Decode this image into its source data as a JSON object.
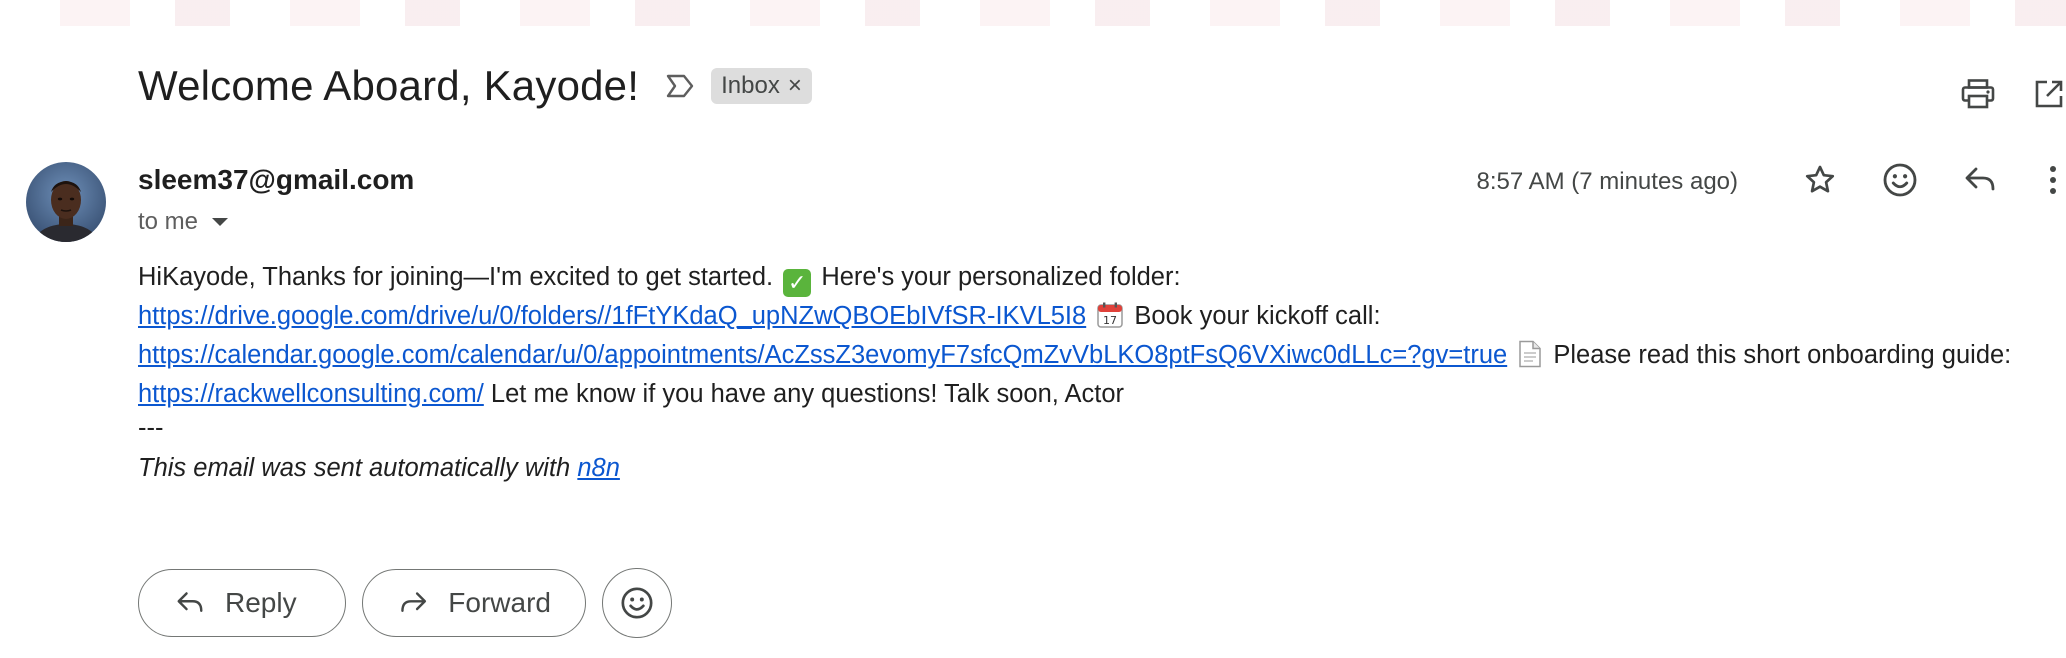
{
  "email": {
    "subject": "Welcome Aboard, Kayode!",
    "label": "Inbox",
    "label_remove": "×",
    "sender": "sleem37@gmail.com",
    "recipient": "to me",
    "time": "8:57 AM (7 minutes ago)"
  },
  "body": {
    "greeting": "HiKayode, Thanks for joining—I'm excited to get started.",
    "folder_text": "Here's your personalized folder:",
    "folder_link": "https://drive.google.com/drive/u/0/folders//1fFtYKdaQ_upNZwQBOEbIVfSR-IKVL5I8",
    "call_text": "Book your kickoff call:",
    "call_link": "https://calendar.google.com/calendar/u/0/appointments/AcZssZ3evomyF7sfcQmZvVbLKO8ptFsQ6VXiwc0dLLc=?gv=true",
    "guide_text": "Please read this short onboarding guide:",
    "guide_link": "https://rackwellconsulting.com/",
    "closing": "Let me know if you have any questions! Talk soon, Actor",
    "calendar_day": "17"
  },
  "signature": {
    "separator": "---",
    "text": "This email was sent automatically with",
    "link": "n8n"
  },
  "buttons": {
    "reply": "Reply",
    "forward": "Forward"
  },
  "icons": {
    "importance": "importance-marker-icon",
    "print": "print-icon",
    "open_new_window": "open-in-new-window-icon",
    "star": "star-icon",
    "emoji": "emoji-reaction-icon",
    "reply": "reply-icon",
    "more": "more-vert-icon",
    "forward": "forward-icon"
  },
  "colors": {
    "link": "#0b57d0",
    "chip_bg": "#dddddd",
    "check_green": "#5ab43c"
  }
}
